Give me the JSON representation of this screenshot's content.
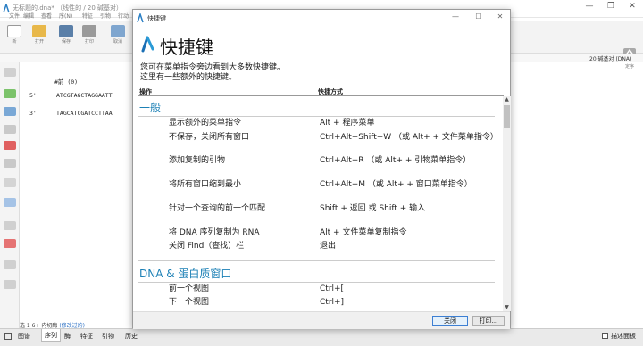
{
  "main": {
    "title": "无标题的.dna* （线性的 / 20 碱基对）",
    "menu": [
      "文件",
      "编辑",
      "查看",
      "序(N)",
      "特征",
      "引物",
      "行动"
    ],
    "toolbar": [
      "新",
      "打开",
      "保存",
      "打印",
      "取消"
    ],
    "right_toolbar_label": "定序",
    "subbar_right": "20 碱基对 (DNA)",
    "seq": {
      "ruler": "#前 (0)",
      "five": "5'",
      "three": "3'",
      "top": "ATCGTAGCTAGGAATT",
      "bottom": "TAGCATCGATCCTTAA"
    },
    "hint_text": "选 1 6+ 内切酶",
    "hint_link": "(修改过的)",
    "tabs": [
      "图谱",
      "序列",
      "酶",
      "特征",
      "引物",
      "历史"
    ],
    "status_right": "描述面板"
  },
  "dialog": {
    "title": "快捷键",
    "heading": "快捷键",
    "intro_line1": "您可在菜单指令旁边看到大多数快捷键。",
    "intro_line2": "这里有一些额外的快捷键。",
    "col_action": "操作",
    "col_shortcut": "快捷方式",
    "sections": [
      {
        "name": "一般",
        "rows": [
          {
            "action": "显示额外的菜单指令",
            "shortcut": "Alt + 程序菜单"
          },
          {
            "action": "不保存，关闭所有窗口",
            "shortcut": "Ctrl+Alt+Shift+W （或 Alt+ + 文件菜单指令）"
          },
          {
            "action": "添加复制的引物",
            "shortcut": "Ctrl+Alt+R （或 Alt+ + 引物菜单指令）"
          },
          {
            "action": "将所有窗口缩到最小",
            "shortcut": "Ctrl+Alt+M （或 Alt+ + 窗口菜单指令）"
          },
          {
            "action": "针对一个查询的前一个匹配",
            "shortcut": "Shift + 返回 或 Shift + 输入"
          },
          {
            "action": "将 DNA 序列复制为 RNA",
            "shortcut": "Alt + 文件菜单复制指令"
          },
          {
            "action": "关闭 Find（查找）栏",
            "shortcut": "退出"
          }
        ]
      },
      {
        "name": "DNA & 蛋白质窗口",
        "rows": [
          {
            "action": "前一个视图",
            "shortcut": "Ctrl+["
          },
          {
            "action": "下一个视图",
            "shortcut": "Ctrl+]"
          }
        ]
      }
    ],
    "close_button": "关闭",
    "print_button": "打印..."
  }
}
